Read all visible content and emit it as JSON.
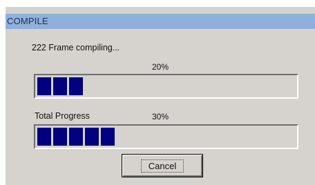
{
  "window": {
    "title": "COMPILE"
  },
  "compile": {
    "status_text": "222 Frame compiling...",
    "frame_percent_label": "20%",
    "frame_progress": 0.2,
    "total_label": "Total Progress",
    "total_percent_label": "30%",
    "total_progress": 0.3
  },
  "buttons": {
    "cancel_label": "Cancel"
  },
  "colors": {
    "title_bar": "#8fb0dc",
    "progress_fill": "#000080",
    "dialog_background": "#d6d3ce"
  }
}
